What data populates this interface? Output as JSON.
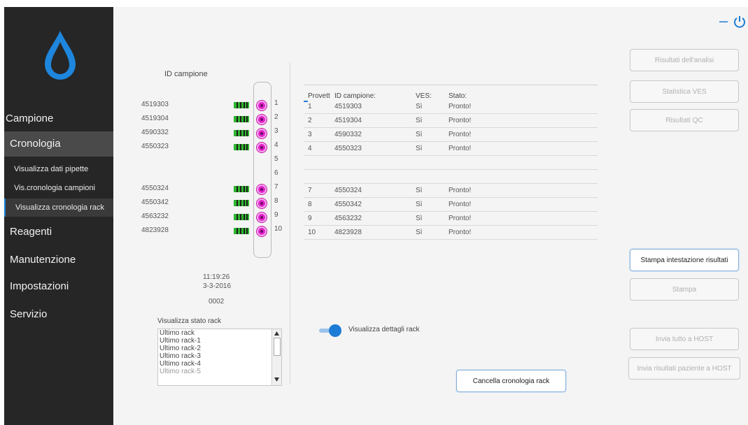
{
  "window": {
    "minimize_label": "–",
    "power_icon": "power-icon"
  },
  "sidebar": {
    "items": [
      {
        "label": "Campione"
      },
      {
        "label": "Cronologia"
      },
      {
        "label": "Reagenti"
      },
      {
        "label": "Manutenzione"
      },
      {
        "label": "Impostazioni"
      },
      {
        "label": "Servizio"
      }
    ],
    "subitems": [
      {
        "label": "Visualizza dati pipette"
      },
      {
        "label": "Vis.cronologia campioni"
      },
      {
        "label": "Visualizza cronologia rack"
      }
    ],
    "logo_icon": "water-drop-icon"
  },
  "rack": {
    "header": "ID campione",
    "slots": [
      {
        "pos": "1",
        "id": "4519303"
      },
      {
        "pos": "2",
        "id": "4519304"
      },
      {
        "pos": "3",
        "id": "4590332"
      },
      {
        "pos": "4",
        "id": "4550323"
      },
      {
        "pos": "5",
        "id": ""
      },
      {
        "pos": "6",
        "id": ""
      },
      {
        "pos": "7",
        "id": "4550324"
      },
      {
        "pos": "8",
        "id": "4550342"
      },
      {
        "pos": "9",
        "id": "4563232"
      },
      {
        "pos": "10",
        "id": "4823928"
      }
    ],
    "time": "11:19:26",
    "date": "3-3-2016",
    "rack_number": "0002"
  },
  "rack_state": {
    "label": "Visualizza stato rack",
    "options": [
      "Ultimo rack",
      "Ultimo rack-1",
      "Ultimo rack-2",
      "Ultimo rack-3",
      "Ultimo rack-4",
      "Ultimo rack-5"
    ]
  },
  "table": {
    "headers": [
      "Provett",
      "ID campione:",
      "VES:",
      "Stato:"
    ],
    "rows": [
      {
        "n": "1",
        "id": "4519303",
        "ves": "Sì",
        "stato": "Pronto!"
      },
      {
        "n": "2",
        "id": "4519304",
        "ves": "Sì",
        "stato": "Pronto!"
      },
      {
        "n": "3",
        "id": "4590332",
        "ves": "Sì",
        "stato": "Pronto!"
      },
      {
        "n": "4",
        "id": "4550323",
        "ves": "Sì",
        "stato": "Pronto!"
      },
      {
        "n": "",
        "id": "",
        "ves": "",
        "stato": ""
      },
      {
        "n": "",
        "id": "",
        "ves": "",
        "stato": ""
      },
      {
        "n": "7",
        "id": "4550324",
        "ves": "Sì",
        "stato": "Pronto!"
      },
      {
        "n": "8",
        "id": "4550342",
        "ves": "Sì",
        "stato": "Pronto!"
      },
      {
        "n": "9",
        "id": "4563232",
        "ves": "Sì",
        "stato": "Pronto!"
      },
      {
        "n": "10",
        "id": "4823928",
        "ves": "Sì",
        "stato": "Pronto!"
      }
    ]
  },
  "toggle": {
    "label": "Visualizza dettagli rack"
  },
  "buttons": {
    "risultati_analisi": "Risultati dell'analisi",
    "statistica_ves": "Statistica VES",
    "risultati_qc": "Risultati QC",
    "stampa_intestazione": "Stampa intestazione risultati",
    "stampa": "Stampa",
    "invia_tutto": "Invia tutto a HOST",
    "invia_paziente": "Invia risultati paziente a HOST",
    "cancella": "Cancella cronologia rack"
  },
  "colors": {
    "sidebar": "#262626",
    "accent": "#1d7cd6",
    "tube": "#e021c9",
    "barcode": "#2fb52f"
  }
}
